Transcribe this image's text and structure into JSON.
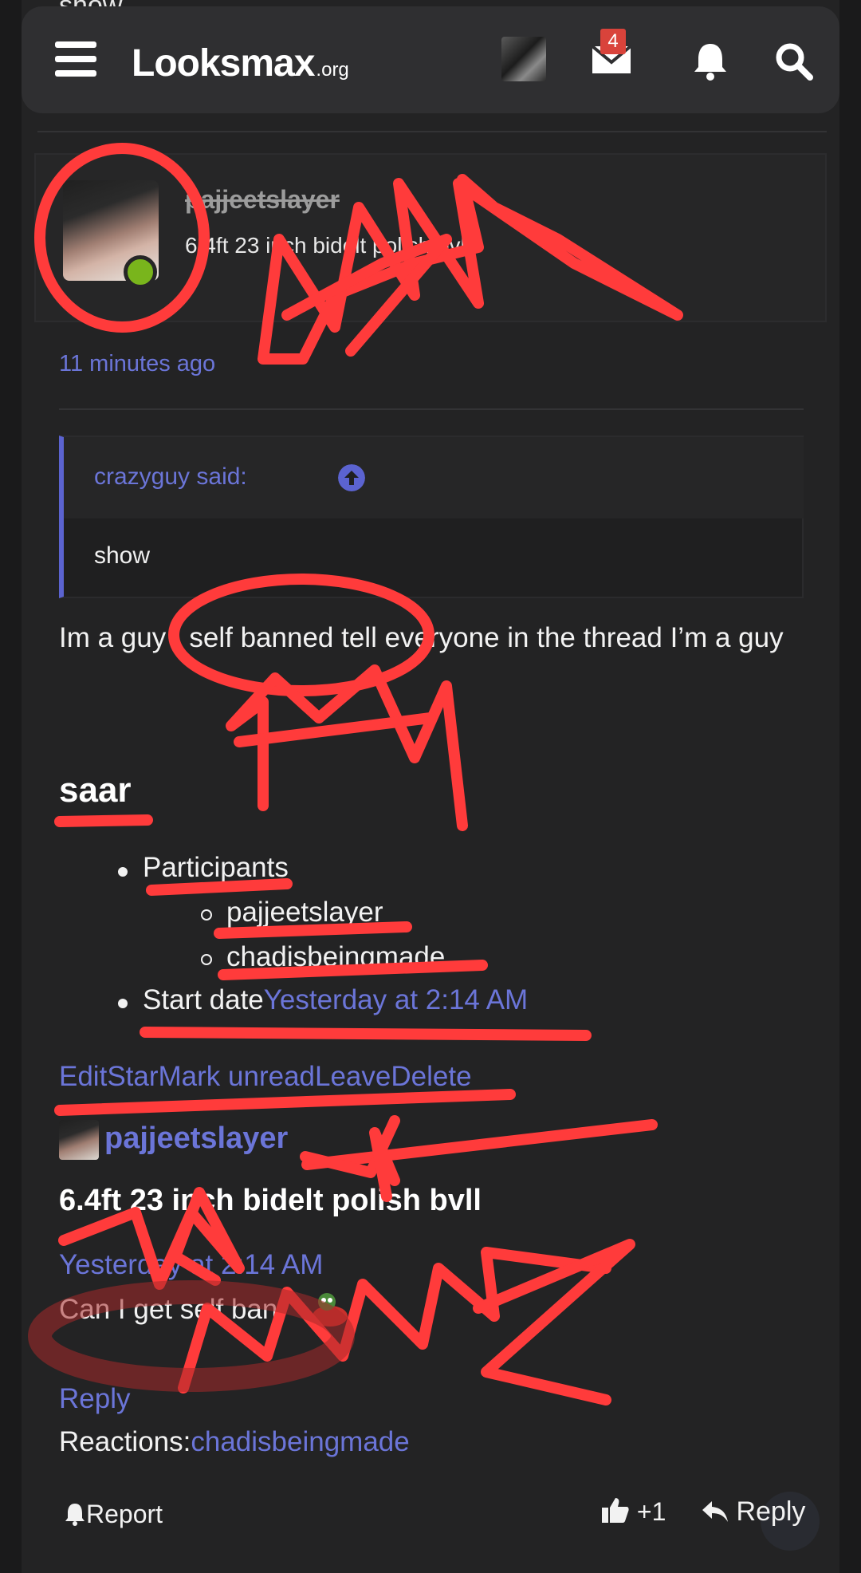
{
  "peek_text": "show",
  "header": {
    "logo_main": "Looksmax",
    "logo_tld": ".org",
    "inbox_count": "4"
  },
  "post": {
    "author": "pajjeetslayer",
    "author_title": "6.4ft 23 inch bidelt polish bvll",
    "time": "11 minutes ago",
    "quote": {
      "attribution": "crazyguy said:",
      "body": "show"
    },
    "body": "Im a guy I self banned tell everyone in the thread I’m a guy"
  },
  "conversation": {
    "title": "saar",
    "participants_label": "Participants",
    "participants": [
      "pajjeetslayer",
      "chadisbeingmade"
    ],
    "start_date_label": "Start date",
    "start_date": "Yesterday at 2:14 AM",
    "actions": [
      "Edit",
      "Star",
      "Mark unread",
      "Leave",
      "Delete"
    ]
  },
  "message": {
    "user": "pajjeetslayer",
    "title": "6.4ft 23 inch bidelt polish bvll",
    "time": "Yesterday at 2:14 AM",
    "text": "Can I get self ban",
    "reply": "Reply",
    "reactions_label": "Reactions:",
    "reactions_user": "chadisbeingmade"
  },
  "footer": {
    "report": "Report",
    "like": "+1",
    "reply": "Reply"
  },
  "colors": {
    "link": "#6b75d8",
    "online": "#79b51c",
    "badge": "#d9433b",
    "scribble": "#ff3b3b"
  }
}
